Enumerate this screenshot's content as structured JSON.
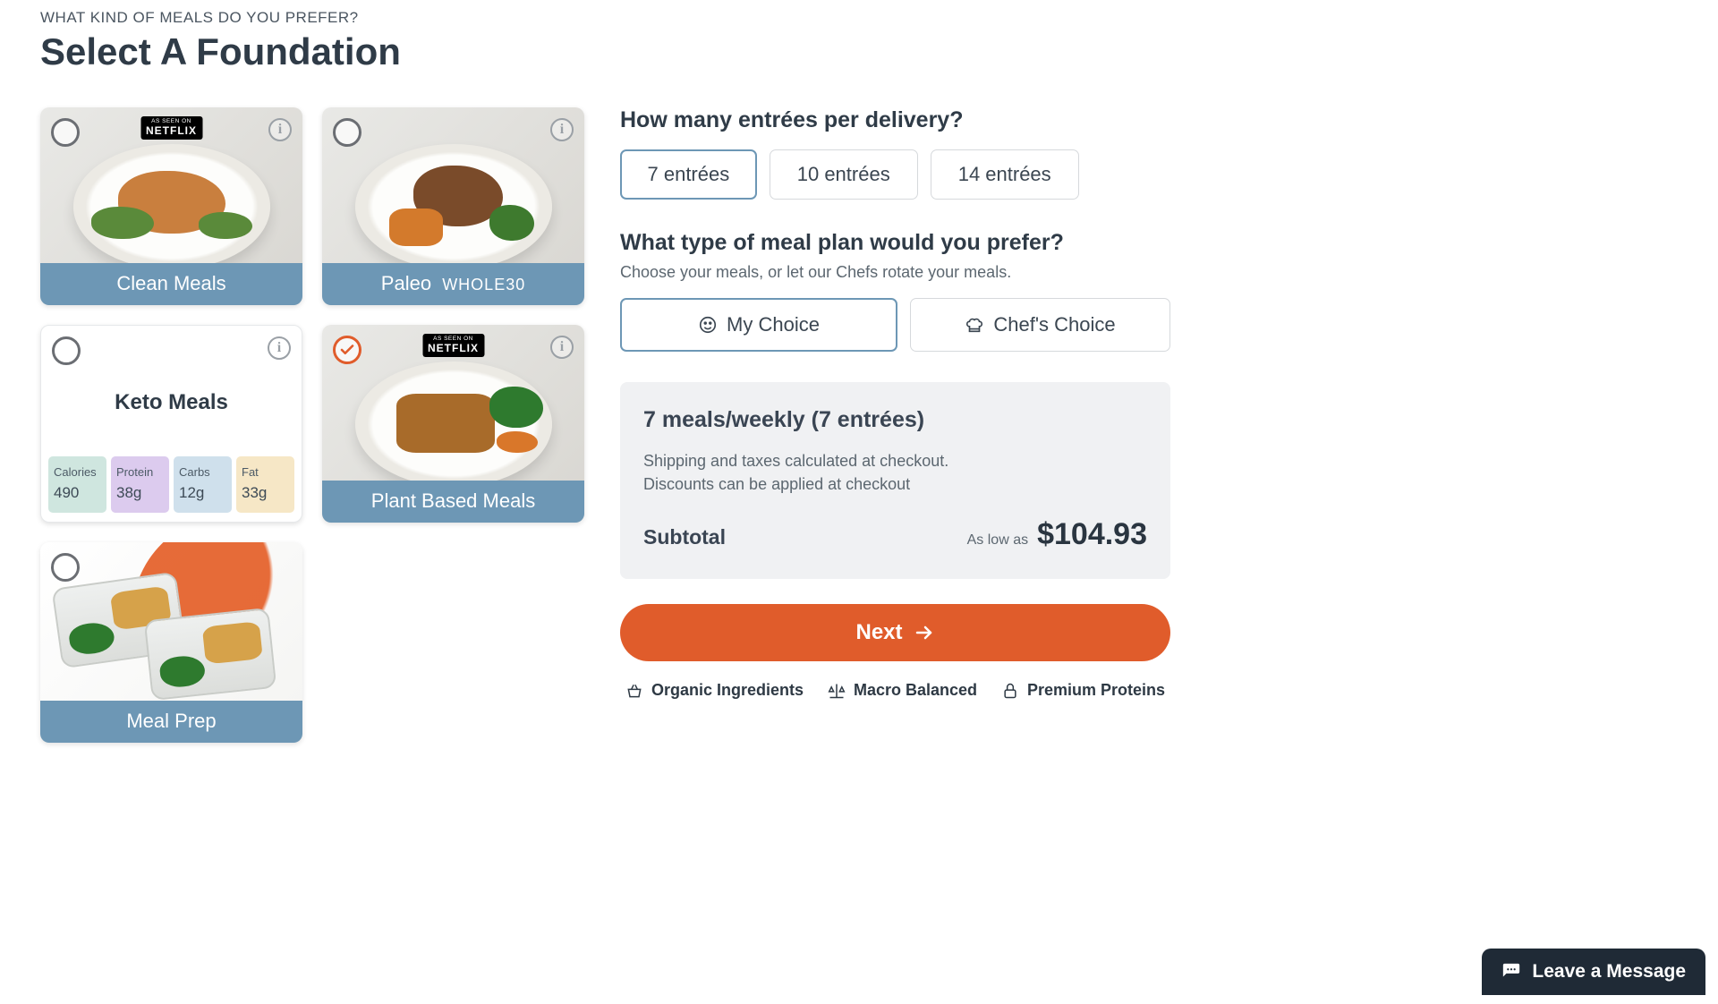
{
  "header": {
    "eyebrow": "WHAT KIND OF MEALS DO YOU PREFER?",
    "title": "Select A Foundation"
  },
  "meals": [
    {
      "id": "clean",
      "label": "Clean Meals",
      "netflix": true,
      "selected": false
    },
    {
      "id": "paleo",
      "label": "Paleo",
      "suffix": "WHOLE30",
      "netflix": false,
      "selected": false
    },
    {
      "id": "keto",
      "label": "Keto Meals",
      "netflix": false,
      "selected": false,
      "macros": {
        "calories_label": "Calories",
        "calories": "490",
        "protein_label": "Protein",
        "protein": "38g",
        "carbs_label": "Carbs",
        "carbs": "12g",
        "fat_label": "Fat",
        "fat": "33g"
      }
    },
    {
      "id": "plant",
      "label": "Plant Based Meals",
      "netflix": true,
      "selected": true
    },
    {
      "id": "prep",
      "label": "Meal Prep",
      "netflix": false,
      "selected": false
    }
  ],
  "entrees": {
    "question": "How many entrées per delivery?",
    "options": [
      "7 entrées",
      "10 entrées",
      "14 entrées"
    ],
    "selected_index": 0
  },
  "plan": {
    "question": "What type of meal plan would you prefer?",
    "subtext": "Choose your meals, or let our Chefs rotate your meals.",
    "options": [
      {
        "icon": "smile",
        "label": "My Choice"
      },
      {
        "icon": "chef",
        "label": "Chef's Choice"
      }
    ],
    "selected_index": 0
  },
  "summary": {
    "title": "7 meals/weekly (7 entrées)",
    "note1": "Shipping and taxes calculated at checkout.",
    "note2": "Discounts can be applied at checkout",
    "subtotal_label": "Subtotal",
    "aslow": "As low as",
    "price": "$104.93"
  },
  "next_label": "Next",
  "trust": [
    {
      "icon": "basket",
      "label": "Organic Ingredients"
    },
    {
      "icon": "scale",
      "label": "Macro Balanced"
    },
    {
      "icon": "lock",
      "label": "Premium Proteins"
    }
  ],
  "chat_label": "Leave a Message"
}
